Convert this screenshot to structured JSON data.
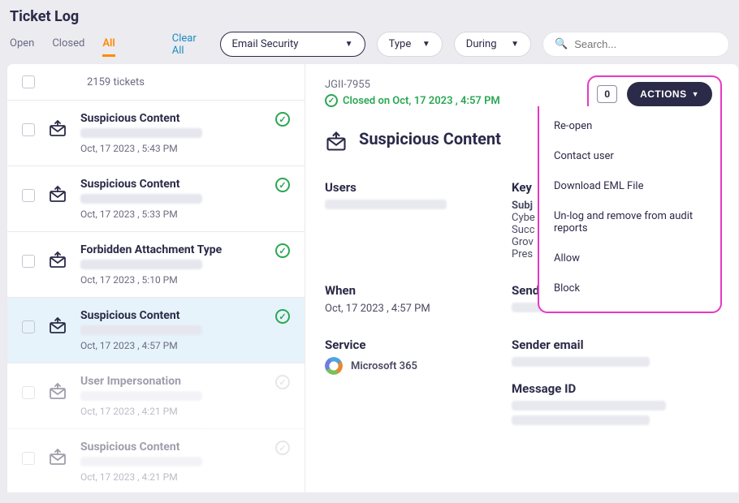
{
  "page_title": "Ticket Log",
  "tabs": {
    "open": "Open",
    "closed": "Closed",
    "all": "All"
  },
  "clear_all": "Clear All",
  "filters": {
    "category": "Email Security",
    "type": "Type",
    "during": "During",
    "search_placeholder": "Search..."
  },
  "list": {
    "count_label": "2159 tickets",
    "rows": [
      {
        "title": "Suspicious Content",
        "date": "Oct, 17 2023 , 5:43 PM",
        "status": "ok"
      },
      {
        "title": "Suspicious Content",
        "date": "Oct, 17 2023 , 5:33 PM",
        "status": "ok"
      },
      {
        "title": "Forbidden Attachment Type",
        "date": "Oct, 17 2023 , 5:10 PM",
        "status": "ok"
      },
      {
        "title": "Suspicious Content",
        "date": "Oct, 17 2023 , 4:57 PM",
        "status": "ok",
        "selected": true
      },
      {
        "title": "User Impersonation",
        "date": "Oct, 17 2023 , 4:21 PM",
        "status": "faded"
      },
      {
        "title": "Suspicious Content",
        "date": "Oct, 17 2023 , 4:21 PM",
        "status": "faded"
      }
    ]
  },
  "detail": {
    "ticket_id": "JGII-7955",
    "closed_label": "Closed on Oct, 17 2023 , 4:57 PM",
    "title": "Suspicious Content",
    "badge_value": "0",
    "actions_label": "ACTIONS",
    "sections": {
      "users_label": "Users",
      "when_label": "When",
      "when_value": "Oct, 17 2023 , 4:57 PM",
      "service_label": "Service",
      "service_value": "Microsoft 365",
      "key_label": "Key",
      "subj_label": "Subj",
      "cybe": "Cybe",
      "succ": "Succ",
      "grov": "Grov",
      "pres": "Pres",
      "sender_name_label": "Sender name",
      "sender_email_label": "Sender email",
      "message_id_label": "Message ID"
    },
    "actions_menu": [
      "Re-open",
      "Contact user",
      "Download EML File",
      "Un-log and remove from audit reports",
      "Allow",
      "Block"
    ]
  }
}
